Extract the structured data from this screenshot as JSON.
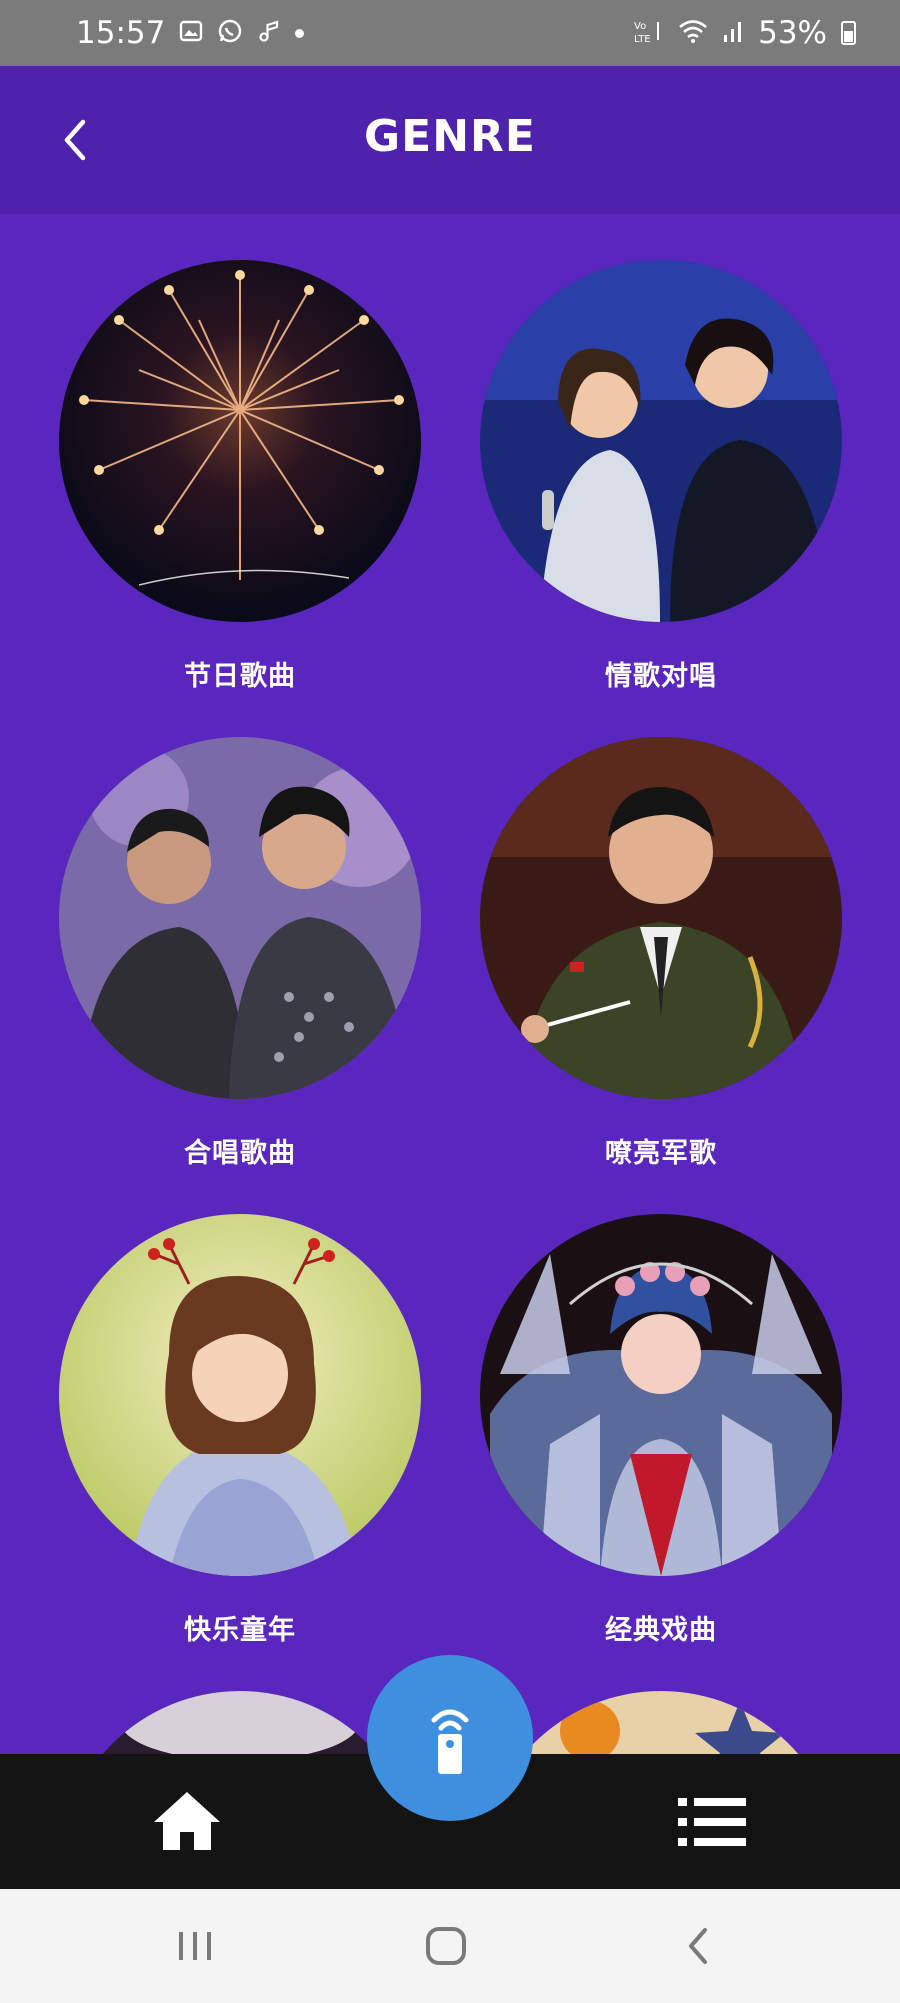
{
  "status_bar": {
    "time": "15:57",
    "battery": "53%",
    "left_icons": [
      "gallery-icon",
      "whatsapp-icon",
      "music-icon",
      "dot-icon"
    ],
    "right_icons": [
      "volte-icon",
      "wifi-icon",
      "signal-icon",
      "battery-icon"
    ]
  },
  "header": {
    "title": "GENRE",
    "back_icon": "chevron-left-icon"
  },
  "genres": [
    {
      "label": "节日歌曲",
      "image": "fireworks"
    },
    {
      "label": "情歌对唱",
      "image": "duet-singers"
    },
    {
      "label": "合唱歌曲",
      "image": "chorus-singers"
    },
    {
      "label": "嘹亮军歌",
      "image": "military-conductor"
    },
    {
      "label": "快乐童年",
      "image": "child"
    },
    {
      "label": "经典戏曲",
      "image": "opera-performer"
    }
  ],
  "bottom_bar": {
    "home_icon": "home-icon",
    "remote_icon": "remote-icon",
    "menu_icon": "list-menu-icon"
  },
  "colors": {
    "background": "#5a27be",
    "header": "#4e22ad",
    "remote_button": "#3f8fdf",
    "bottom_bar": "#141414"
  }
}
